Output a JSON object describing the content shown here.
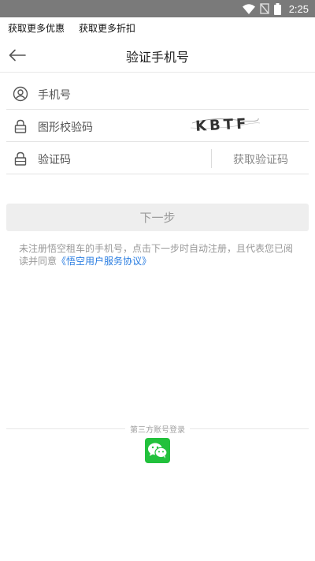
{
  "status_bar": {
    "time": "2:25",
    "icons": [
      "wifi-icon",
      "no-signal-icon",
      "battery-icon"
    ]
  },
  "promo": {
    "links": [
      "获取更多优惠",
      "获取更多折扣"
    ]
  },
  "header": {
    "back_icon": "arrow-left-icon",
    "title": "验证手机号"
  },
  "form": {
    "phone": {
      "label": "手机号",
      "icon": "user-icon"
    },
    "captcha": {
      "label": "图形校验码",
      "icon": "lock-icon",
      "captcha_text": "KBTF"
    },
    "sms": {
      "label": "验证码",
      "icon": "lock-icon",
      "button": "获取验证码"
    }
  },
  "actions": {
    "next_label": "下一步"
  },
  "agreement": {
    "text": "未注册悟空租车的手机号，点击下一步时自动注册，且代表您已阅读并同意",
    "link": "《悟空用户服务协议》"
  },
  "third_party": {
    "label": "第三方账号登录",
    "wechat_icon": "wechat-icon"
  },
  "colors": {
    "status_bar": "#7a7a7a",
    "link": "#2a7de1",
    "wechat": "#22c13c",
    "disabled_button": "#eeeeee"
  }
}
